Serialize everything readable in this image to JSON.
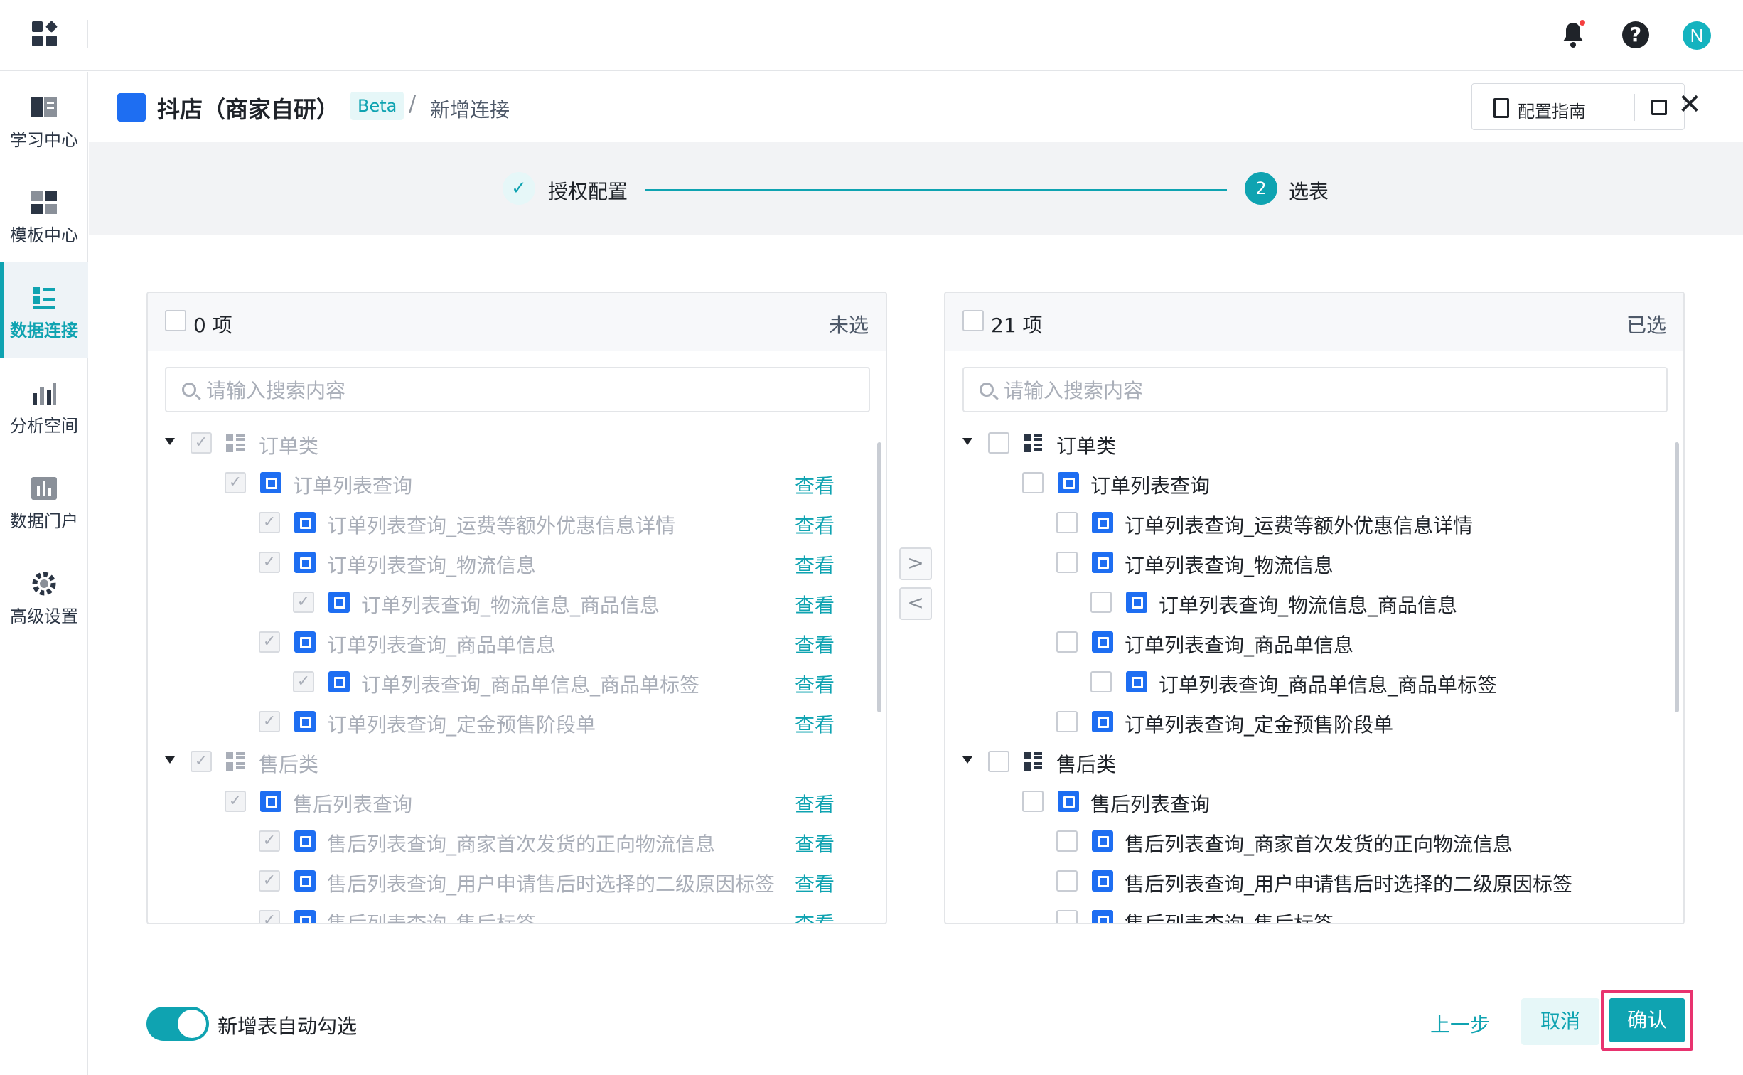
{
  "topbar": {
    "user_initial": "N",
    "help_glyph": "?"
  },
  "sidebar": {
    "items": [
      {
        "label": "学习中心",
        "icon": "book-icon"
      },
      {
        "label": "模板中心",
        "icon": "template-icon"
      },
      {
        "label": "数据连接",
        "icon": "data-connection-icon",
        "active": true
      },
      {
        "label": "分析空间",
        "icon": "analysis-icon"
      },
      {
        "label": "数据门户",
        "icon": "portal-icon"
      },
      {
        "label": "高级设置",
        "icon": "settings-icon"
      }
    ]
  },
  "header": {
    "title": "抖店（商家自研）",
    "badge": "Beta",
    "separator": "/",
    "crumb": "新增连接",
    "guide_label": "配置指南",
    "close_glyph": "✕"
  },
  "steps": {
    "step1": {
      "label": "授权配置",
      "glyph": "✓"
    },
    "step2": {
      "label": "选表",
      "number": "2"
    }
  },
  "left_panel": {
    "count": "0 项",
    "state": "未选",
    "search_placeholder": "请输入搜索内容",
    "rows": [
      {
        "text": "订单类",
        "level": 0,
        "type": "category",
        "view": ""
      },
      {
        "text": "订单列表查询",
        "level": 1,
        "type": "table",
        "view": "查看"
      },
      {
        "text": "订单列表查询_运费等额外优惠信息详情",
        "level": 2,
        "type": "table",
        "view": "查看"
      },
      {
        "text": "订单列表查询_物流信息",
        "level": 2,
        "type": "table",
        "view": "查看"
      },
      {
        "text": "订单列表查询_物流信息_商品信息",
        "level": 3,
        "type": "table",
        "view": "查看"
      },
      {
        "text": "订单列表查询_商品单信息",
        "level": 2,
        "type": "table",
        "view": "查看"
      },
      {
        "text": "订单列表查询_商品单信息_商品单标签",
        "level": 3,
        "type": "table",
        "view": "查看"
      },
      {
        "text": "订单列表查询_定金预售阶段单",
        "level": 2,
        "type": "table",
        "view": "查看"
      },
      {
        "text": "售后类",
        "level": 0,
        "type": "category",
        "view": ""
      },
      {
        "text": "售后列表查询",
        "level": 1,
        "type": "table",
        "view": "查看"
      },
      {
        "text": "售后列表查询_商家首次发货的正向物流信息",
        "level": 2,
        "type": "table",
        "view": "查看"
      },
      {
        "text": "售后列表查询_用户申请售后时选择的二级原因标签",
        "level": 2,
        "type": "table",
        "view": "查看"
      },
      {
        "text": "售后列表查询_售后标签",
        "level": 2,
        "type": "table",
        "view": "查看"
      }
    ]
  },
  "right_panel": {
    "count": "21 项",
    "state": "已选",
    "search_placeholder": "请输入搜索内容",
    "rows": [
      {
        "text": "订单类",
        "level": 0,
        "type": "category"
      },
      {
        "text": "订单列表查询",
        "level": 1,
        "type": "table"
      },
      {
        "text": "订单列表查询_运费等额外优惠信息详情",
        "level": 2,
        "type": "table"
      },
      {
        "text": "订单列表查询_物流信息",
        "level": 2,
        "type": "table"
      },
      {
        "text": "订单列表查询_物流信息_商品信息",
        "level": 3,
        "type": "table"
      },
      {
        "text": "订单列表查询_商品单信息",
        "level": 2,
        "type": "table"
      },
      {
        "text": "订单列表查询_商品单信息_商品单标签",
        "level": 3,
        "type": "table"
      },
      {
        "text": "订单列表查询_定金预售阶段单",
        "level": 2,
        "type": "table"
      },
      {
        "text": "售后类",
        "level": 0,
        "type": "category"
      },
      {
        "text": "售后列表查询",
        "level": 1,
        "type": "table"
      },
      {
        "text": "售后列表查询_商家首次发货的正向物流信息",
        "level": 2,
        "type": "table"
      },
      {
        "text": "售后列表查询_用户申请售后时选择的二级原因标签",
        "level": 2,
        "type": "table"
      },
      {
        "text": "售后列表查询_售后标签",
        "level": 2,
        "type": "table"
      }
    ]
  },
  "transfer": {
    "to_right": ">",
    "to_left": "<"
  },
  "footer": {
    "toggle_label": "新增表自动勾选",
    "toggle_on": true,
    "prev_label": "上一步",
    "cancel_label": "取消",
    "confirm_label": "确认"
  },
  "colors": {
    "accent": "#0fa3b1",
    "brand_blue": "#1e6ef2",
    "highlight": "#e8336f"
  }
}
